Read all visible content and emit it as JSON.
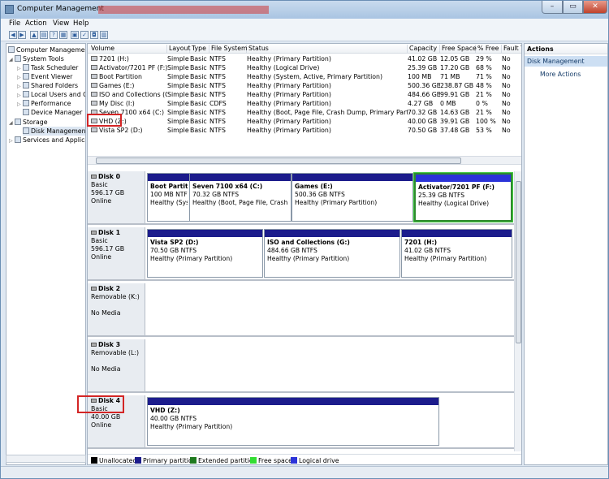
{
  "window": {
    "title": "Computer Management"
  },
  "menu": [
    "File",
    "Action",
    "View",
    "Help"
  ],
  "tree": [
    {
      "label": "Computer Management",
      "indent": 0,
      "expander": ""
    },
    {
      "label": "System Tools",
      "indent": 1,
      "expander": "◢"
    },
    {
      "label": "Task Scheduler",
      "indent": 2,
      "expander": "▷"
    },
    {
      "label": "Event Viewer",
      "indent": 2,
      "expander": "▷"
    },
    {
      "label": "Shared Folders",
      "indent": 2,
      "expander": "▷"
    },
    {
      "label": "Local Users and Gr",
      "indent": 2,
      "expander": "▷"
    },
    {
      "label": "Performance",
      "indent": 2,
      "expander": "▷"
    },
    {
      "label": "Device Manager",
      "indent": 2,
      "expander": ""
    },
    {
      "label": "Storage",
      "indent": 1,
      "expander": "◢"
    },
    {
      "label": "Disk Management",
      "indent": 2,
      "expander": ""
    },
    {
      "label": "Services and Applicat",
      "indent": 1,
      "expander": "▷"
    }
  ],
  "volume_table": {
    "columns": [
      "Volume",
      "Layout",
      "Type",
      "File System",
      "Status",
      "Capacity",
      "Free Space",
      "% Free",
      "Fault T"
    ],
    "rows": [
      [
        "7201 (H:)",
        "Simple",
        "Basic",
        "NTFS",
        "Healthy (Primary Partition)",
        "41.02 GB",
        "12.05 GB",
        "29 %",
        "No"
      ],
      [
        "Activator/7201 PF (F:)",
        "Simple",
        "Basic",
        "NTFS",
        "Healthy (Logical Drive)",
        "25.39 GB",
        "17.20 GB",
        "68 %",
        "No"
      ],
      [
        "Boot Partition",
        "Simple",
        "Basic",
        "NTFS",
        "Healthy (System, Active, Primary Partition)",
        "100 MB",
        "71 MB",
        "71 %",
        "No"
      ],
      [
        "Games (E:)",
        "Simple",
        "Basic",
        "NTFS",
        "Healthy (Primary Partition)",
        "500.36 GB",
        "238.87 GB",
        "48 %",
        "No"
      ],
      [
        "ISO and Collections (G:)",
        "Simple",
        "Basic",
        "NTFS",
        "Healthy (Primary Partition)",
        "484.66 GB",
        "99.91 GB",
        "21 %",
        "No"
      ],
      [
        "My Disc (I:)",
        "Simple",
        "Basic",
        "CDFS",
        "Healthy (Primary Partition)",
        "4.27 GB",
        "0 MB",
        "0 %",
        "No"
      ],
      [
        "Seven 7100 x64 (C:)",
        "Simple",
        "Basic",
        "NTFS",
        "Healthy (Boot, Page File, Crash Dump, Primary Partition)",
        "70.32 GB",
        "14.63 GB",
        "21 %",
        "No"
      ],
      [
        "VHD (Z:)",
        "Simple",
        "Basic",
        "NTFS",
        "Healthy (Primary Partition)",
        "40.00 GB",
        "39.91 GB",
        "100 %",
        "No"
      ],
      [
        "Vista SP2 (D:)",
        "Simple",
        "Basic",
        "NTFS",
        "Healthy (Primary Partition)",
        "70.50 GB",
        "37.48 GB",
        "53 %",
        "No"
      ]
    ]
  },
  "disks": [
    {
      "name": "Disk 0",
      "type": "Basic",
      "size": "596.17 GB",
      "state": "Online",
      "partitions": [
        {
          "name": "Boot Partiti",
          "size": "100 MB NTFS",
          "status": "Healthy (Syst",
          "kind": "primary"
        },
        {
          "name": "Seven 7100 x64  (C:)",
          "size": "70.32 GB NTFS",
          "status": "Healthy (Boot, Page File, Crash Du",
          "kind": "primary"
        },
        {
          "name": "Games  (E:)",
          "size": "500.36 GB NTFS",
          "status": "Healthy (Primary Partition)",
          "kind": "primary"
        },
        {
          "name": "Activator/7201 PF  (F:)",
          "size": "25.39 GB NTFS",
          "status": "Healthy (Logical Drive)",
          "kind": "logical"
        }
      ]
    },
    {
      "name": "Disk 1",
      "type": "Basic",
      "size": "596.17 GB",
      "state": "Online",
      "partitions": [
        {
          "name": "Vista SP2  (D:)",
          "size": "70.50 GB NTFS",
          "status": "Healthy (Primary Partition)",
          "kind": "primary"
        },
        {
          "name": "ISO and Collections  (G:)",
          "size": "484.66 GB NTFS",
          "status": "Healthy (Primary Partition)",
          "kind": "primary"
        },
        {
          "name": "7201  (H:)",
          "size": "41.02 GB NTFS",
          "status": "Healthy (Primary Partition)",
          "kind": "primary"
        }
      ]
    },
    {
      "name": "Disk 2",
      "type": "Removable (K:)",
      "size": "",
      "state": "No Media",
      "partitions": []
    },
    {
      "name": "Disk 3",
      "type": "Removable (L:)",
      "size": "",
      "state": "No Media",
      "partitions": []
    },
    {
      "name": "Disk 4",
      "type": "Basic",
      "size": "40.00 GB",
      "state": "Online",
      "partitions": [
        {
          "name": "VHD  (Z:)",
          "size": "40.00 GB NTFS",
          "status": "Healthy (Primary Partition)",
          "kind": "primary"
        }
      ]
    }
  ],
  "legend": [
    {
      "label": "Unallocated",
      "color": "#000000"
    },
    {
      "label": "Primary partition",
      "color": "#1c1c8c"
    },
    {
      "label": "Extended partition",
      "color": "#1f7a1f"
    },
    {
      "label": "Free space",
      "color": "#33dd33"
    },
    {
      "label": "Logical drive",
      "color": "#2b33d8"
    }
  ],
  "actions": {
    "header": "Actions",
    "selected": "Disk Management",
    "more": "More Actions"
  }
}
